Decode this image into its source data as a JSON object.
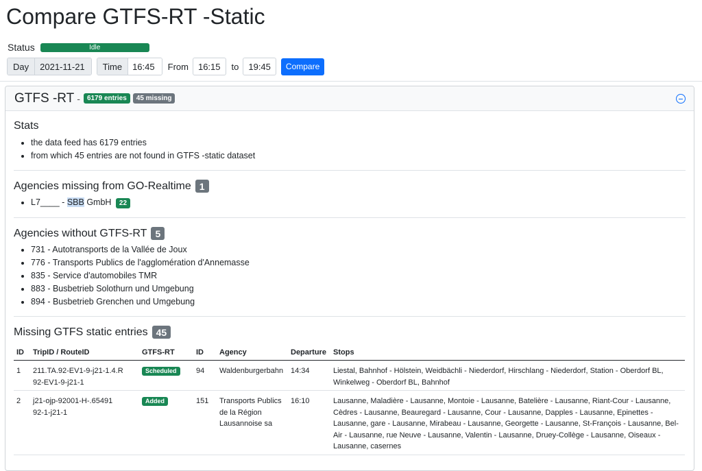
{
  "page": {
    "title": "Compare GTFS-RT -Static"
  },
  "status": {
    "label": "Status",
    "value": "Idle",
    "color": "#198754"
  },
  "controls": {
    "day_label": "Day",
    "day_value": "2021-11-21",
    "time_label": "Time",
    "time_value": "16:45",
    "from_label": "From",
    "from_value": "16:15",
    "to_label": "to",
    "to_value": "19:45",
    "compare_label": "Compare"
  },
  "card": {
    "title": "GTFS -RT",
    "separator": "-",
    "entries_badge": "6179 entries",
    "missing_badge": "45 missing",
    "collapse_icon": "minus-circle-icon"
  },
  "stats": {
    "heading": "Stats",
    "items": [
      "the data feed has 6179 entries",
      "from which 45 entries are not found in GTFS -static dataset"
    ]
  },
  "agencies_missing": {
    "heading": "Agencies missing from GO-Realtime",
    "count": "1",
    "items": [
      {
        "prefix": "L7____ - ",
        "highlight": "SBB",
        "suffix": " GmbH",
        "count": "22"
      }
    ]
  },
  "agencies_without": {
    "heading": "Agencies without GTFS-RT",
    "count": "5",
    "items": [
      "731 - Autotransports de la Vallée de Joux",
      "776 - Transports Publics de l'agglomération d'Annemasse",
      "835 - Service d'automobiles TMR",
      "883 - Busbetrieb Solothurn und Umgebung",
      "894 - Busbetrieb Grenchen und Umgebung"
    ]
  },
  "missing_entries": {
    "heading": "Missing GTFS static entries",
    "count": "45",
    "columns": [
      "ID",
      "TripID / RouteID",
      "GTFS-RT",
      "ID",
      "Agency",
      "Departure",
      "Stops"
    ],
    "rows": [
      {
        "id": "1",
        "trip_id": "211.TA.92-EV1-9-j21-1.4.R",
        "route_id": "92-EV1-9-j21-1",
        "rt_status": "Scheduled",
        "agency_id": "94",
        "agency": "Waldenburgerbahn",
        "departure": "14:34",
        "stops": "Liestal, Bahnhof - Hölstein, Weidbächli - Niederdorf, Hirschlang - Niederdorf, Station - Oberdorf BL, Winkelweg - Oberdorf BL, Bahnhof"
      },
      {
        "id": "2",
        "trip_id": "j21-ojp-92001-H-.65491",
        "route_id": "92-1-j21-1",
        "rt_status": "Added",
        "agency_id": "151",
        "agency": "Transports Publics de la Région Lausannoise sa",
        "departure": "16:10",
        "stops": "Lausanne, Maladière - Lausanne, Montoie - Lausanne, Batelière - Lausanne, Riant-Cour - Lausanne, Cèdres - Lausanne, Beauregard - Lausanne, Cour - Lausanne, Dapples - Lausanne, Epinettes - Lausanne, gare - Lausanne, Mirabeau - Lausanne, Georgette - Lausanne, St-François - Lausanne, Bel-Air - Lausanne, rue Neuve - Lausanne, Valentin - Lausanne, Druey-Collège - Lausanne, Oiseaux - Lausanne, casernes"
      }
    ]
  }
}
